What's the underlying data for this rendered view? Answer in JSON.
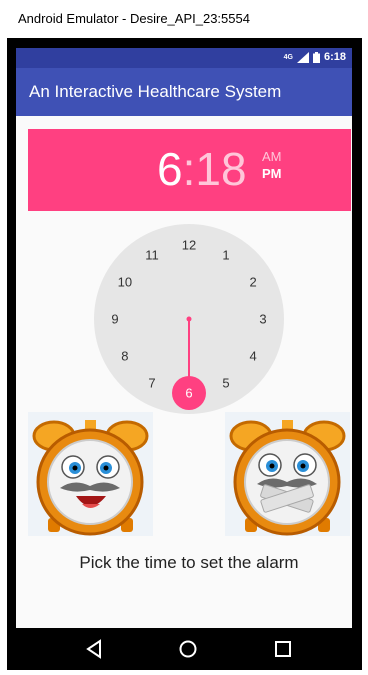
{
  "window": {
    "title": "Android Emulator - Desire_API_23:5554"
  },
  "status_bar": {
    "network": "4G",
    "time": "6:18"
  },
  "app_bar": {
    "title": "An Interactive Healthcare System"
  },
  "time_picker": {
    "hour": "6",
    "separator": ":",
    "minute": "18",
    "am_label": "AM",
    "pm_label": "PM",
    "selected_period": "PM",
    "dial_numbers": [
      "12",
      "1",
      "2",
      "3",
      "4",
      "5",
      "6",
      "7",
      "8",
      "9",
      "10",
      "11"
    ],
    "selected_hour": "6",
    "accent_color": "#ff4081"
  },
  "images": {
    "left_clock": "happy-alarm-clock-icon",
    "right_clock": "taped-mouth-alarm-clock-icon"
  },
  "caption": "Pick the time to set the alarm",
  "nav_bar": {
    "back": "back-icon",
    "home": "home-icon",
    "recents": "recents-icon"
  },
  "colors": {
    "status_bar": "#303f9f",
    "app_bar": "#3f51b5",
    "accent": "#ff4081",
    "dial": "#e6e6e6"
  }
}
